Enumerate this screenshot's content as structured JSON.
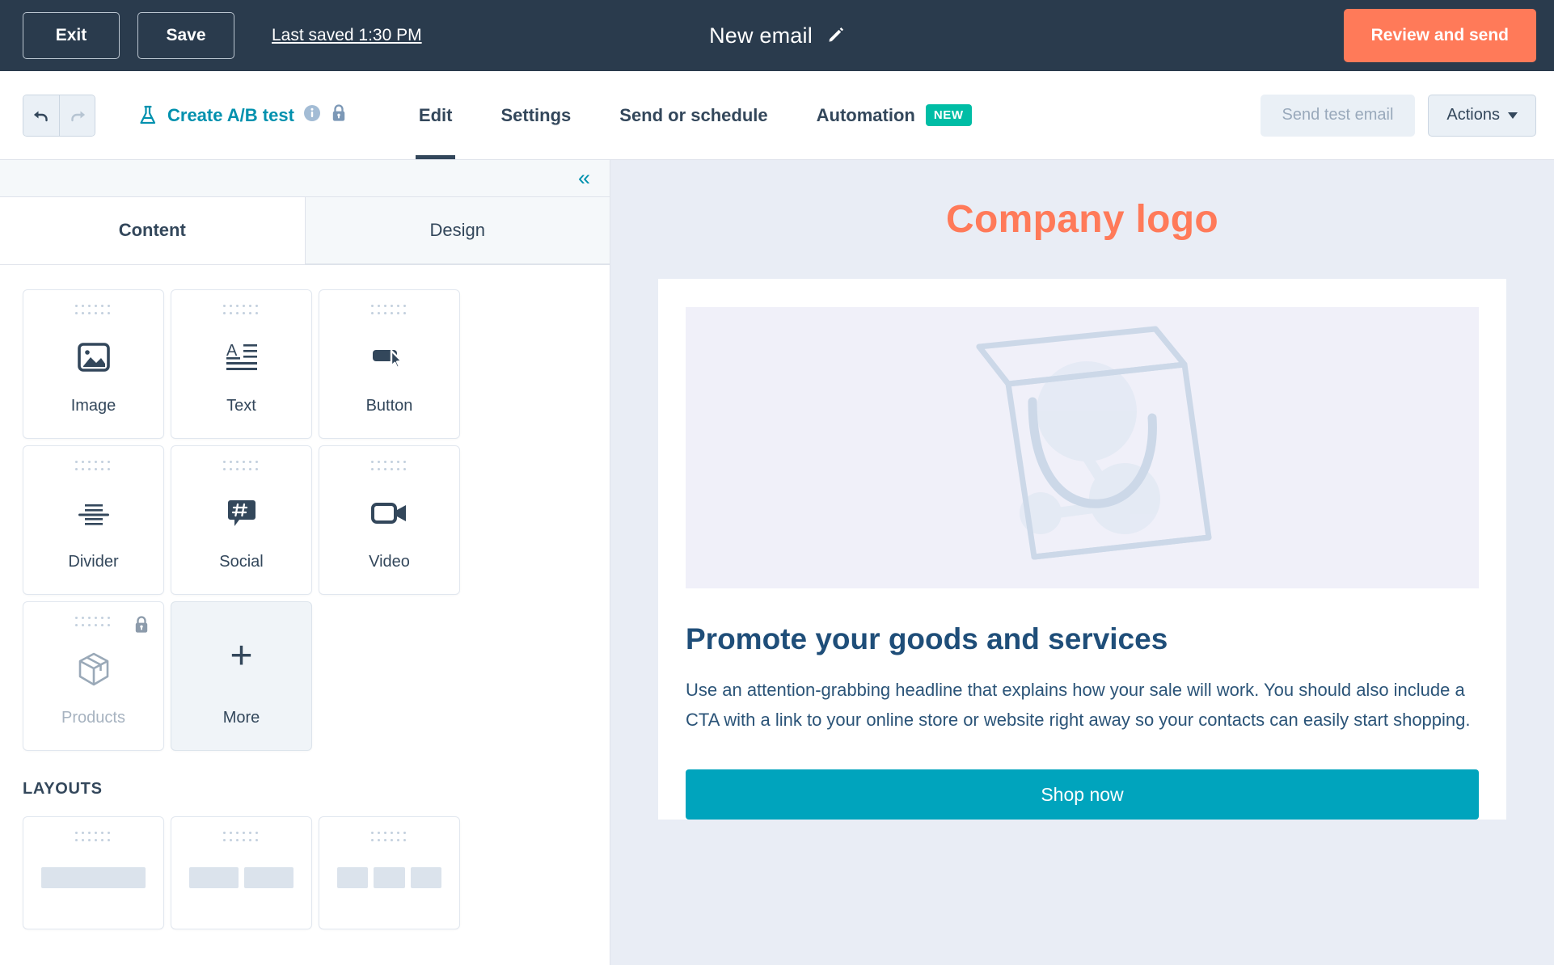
{
  "topbar": {
    "exit_label": "Exit",
    "save_label": "Save",
    "last_saved": "Last saved 1:30 PM",
    "email_title": "New email",
    "review_label": "Review and send"
  },
  "navbar": {
    "undo_name": "undo",
    "redo_name": "redo",
    "ab_test_label": "Create A/B test",
    "tabs": [
      {
        "label": "Edit",
        "active": true
      },
      {
        "label": "Settings",
        "active": false
      },
      {
        "label": "Send or schedule",
        "active": false
      },
      {
        "label": "Automation",
        "active": false,
        "badge": "NEW"
      }
    ],
    "send_test_label": "Send test email",
    "actions_label": "Actions"
  },
  "sidebar": {
    "collapse_glyph": "«",
    "tabs": [
      {
        "label": "Content",
        "active": true
      },
      {
        "label": "Design",
        "active": false
      }
    ],
    "modules": [
      {
        "label": "Image",
        "icon": "image-icon",
        "locked": false,
        "variant": "default"
      },
      {
        "label": "Text",
        "icon": "text-icon",
        "locked": false,
        "variant": "default"
      },
      {
        "label": "Button",
        "icon": "button-icon",
        "locked": false,
        "variant": "default"
      },
      {
        "label": "Divider",
        "icon": "divider-icon",
        "locked": false,
        "variant": "default"
      },
      {
        "label": "Social",
        "icon": "social-icon",
        "locked": false,
        "variant": "default"
      },
      {
        "label": "Video",
        "icon": "video-icon",
        "locked": false,
        "variant": "default"
      },
      {
        "label": "Products",
        "icon": "products-icon",
        "locked": true,
        "variant": "disabled"
      },
      {
        "label": "More",
        "icon": "plus-icon",
        "locked": false,
        "variant": "more"
      }
    ],
    "layouts_heading": "LAYOUTS",
    "layouts": [
      {
        "columns": 1
      },
      {
        "columns": 2
      },
      {
        "columns": 3
      }
    ]
  },
  "preview": {
    "company_logo": "Company logo",
    "image_alt": "shopping-bag-placeholder",
    "heading": "Promote your goods and services",
    "body": "Use an attention-grabbing headline that explains how your sale will work. You should also include a CTA with a link to your online store or website right away so your contacts can easily start shopping.",
    "cta_label": "Shop now"
  },
  "colors": {
    "topbar_bg": "#2a3b4d",
    "accent_orange": "#ff7a59",
    "accent_teal": "#0091ae",
    "cta_teal": "#00a4bd",
    "badge_green": "#00bda5",
    "preview_bg": "#e9edf5",
    "heading_blue": "#1f4e79"
  }
}
